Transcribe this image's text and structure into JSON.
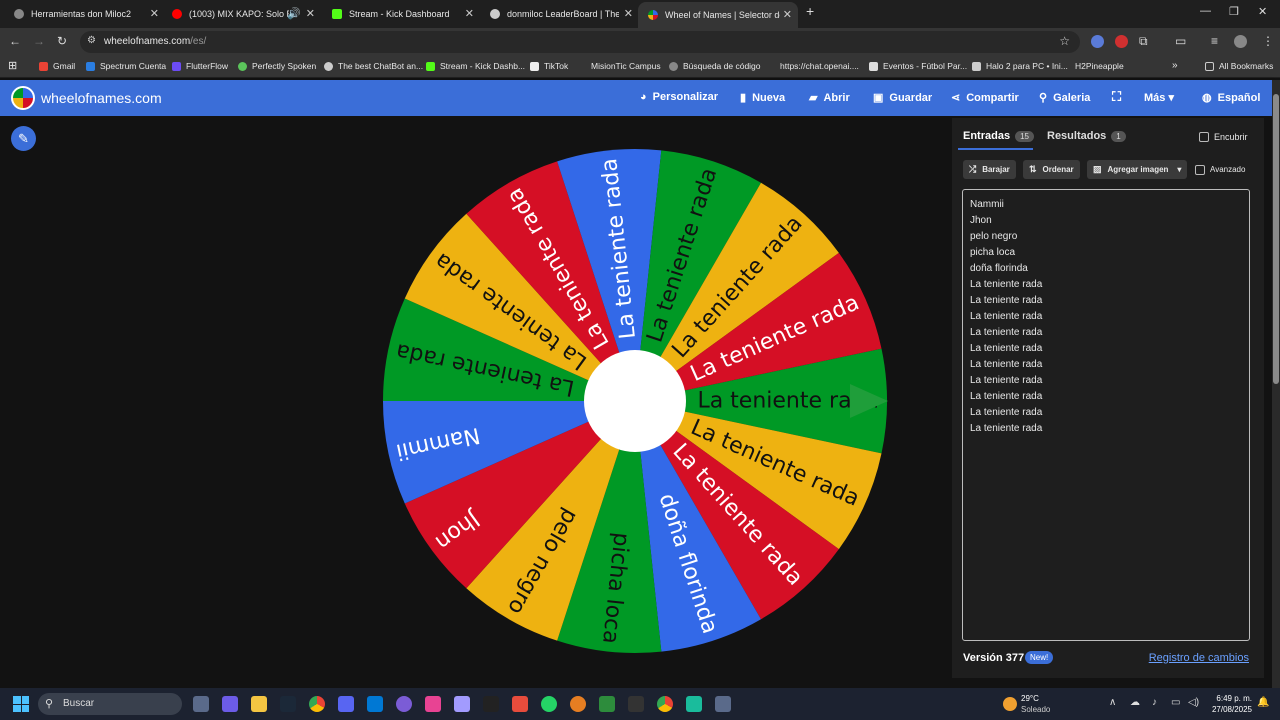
{
  "browser": {
    "tabs": [
      {
        "title": "Herramientas don Miloc2",
        "color": "#888888"
      },
      {
        "title": "(1003) MIX KAPO: Solo Éxito",
        "color": "#ff0000"
      },
      {
        "title": "Stream - Kick Dashboard",
        "color": "#53fc18"
      },
      {
        "title": "donmiloc LeaderBoard | The be",
        "color": "#cccccc"
      },
      {
        "title": "Wheel of Names | Selector de n",
        "color": "#3b6ed8"
      }
    ],
    "url_host": "wheelofnames.com",
    "url_path": "/es/",
    "bookmarks": [
      {
        "label": "Gmail",
        "color": "#ea4335"
      },
      {
        "label": "Spectrum Cuenta",
        "color": "#2a7de1"
      },
      {
        "label": "FlutterFlow",
        "color": "#6c4cf5"
      },
      {
        "label": "Perfectly Spoken",
        "color": "#5bc45b"
      },
      {
        "label": "The best ChatBot an...",
        "color": "#cccccc"
      },
      {
        "label": "Stream - Kick Dashb...",
        "color": "#53fc18"
      },
      {
        "label": "TikTok",
        "color": "#eeeeee"
      },
      {
        "label": "MisionTic  Campus",
        "color": "#353535"
      },
      {
        "label": "Búsqueda de código",
        "color": "#888888"
      },
      {
        "label": "https://chat.openai....",
        "color": "#353535"
      },
      {
        "label": "Eventos - Fútbol Par...",
        "color": "#dddddd"
      },
      {
        "label": "Halo 2 para PC • Ini...",
        "color": "#cccccc"
      },
      {
        "label": "H2Pineapple",
        "color": "#3b6ed8"
      }
    ],
    "all_bookmarks": "All Bookmarks"
  },
  "header": {
    "brand": "wheelofnames.com",
    "nav": [
      {
        "label": "Personalizar",
        "icon": "palette-icon",
        "glyph": "🎨"
      },
      {
        "label": "Nueva",
        "icon": "document-icon",
        "glyph": "▇"
      },
      {
        "label": "Abrir",
        "icon": "folder-icon",
        "glyph": "▭"
      },
      {
        "label": "Guardar",
        "icon": "save-icon",
        "glyph": "▣"
      },
      {
        "label": "Compartir",
        "icon": "share-icon",
        "glyph": "⋖"
      },
      {
        "label": "Galeria",
        "icon": "search-icon",
        "glyph": "⚲"
      },
      {
        "label": "",
        "icon": "fullscreen-icon",
        "glyph": "⛶"
      },
      {
        "label": "Más ▾",
        "icon": "",
        "glyph": ""
      },
      {
        "label": "Español",
        "icon": "globe-icon",
        "glyph": "◍"
      }
    ]
  },
  "wheel": {
    "colors": [
      "#009925",
      "#eeb211",
      "#d50f25",
      "#3369e8"
    ],
    "pointer_color": "#1f9e3a",
    "segments": [
      "La teniente rada",
      "La teniente rada",
      "La teniente rada",
      "doña florinda",
      "picha loca",
      "pelo negro",
      "Jhon",
      "Nammii",
      "La teniente rada",
      "La teniente rada",
      "La teniente rada",
      "La teniente rada",
      "La teniente rada",
      "La teniente rada",
      "La teniente rada"
    ]
  },
  "panel": {
    "tab_entries": "Entradas",
    "entries_count": "15",
    "tab_results": "Resultados",
    "results_count": "1",
    "hide_label": "Encubrir",
    "shuffle": "Barajar",
    "sort": "Ordenar",
    "add_image": "Agregar imagen",
    "advanced": "Avanzado",
    "entries": [
      "Nammii",
      "Jhon",
      "pelo negro",
      "picha loca",
      "doña florinda",
      "La teniente rada",
      "La teniente rada",
      "La teniente rada",
      "La teniente rada",
      "La teniente rada",
      "La teniente rada",
      "La teniente rada",
      "La teniente rada",
      "La teniente rada",
      "La teniente rada"
    ],
    "version": "Versión 377",
    "new_badge": "New!",
    "changelog": "Registro de cambios"
  },
  "taskbar": {
    "search": "Buscar",
    "weather_temp": "29°C",
    "weather_desc": "Soleado",
    "time": "6:49 p. m.",
    "date": "27/08/2025"
  }
}
